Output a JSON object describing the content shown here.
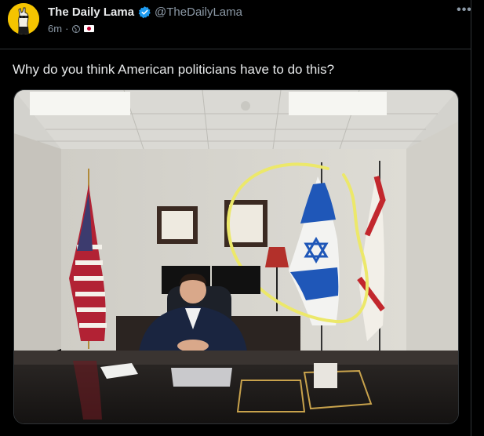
{
  "post": {
    "author_name": "The Daily Lama",
    "handle": "@TheDailyLama",
    "timestamp": "6m",
    "separator": "·",
    "more_label": "•••",
    "text": "Why do you think American politicians have to do this?",
    "icons": {
      "verified": "verified-badge-icon",
      "globe": "globe-icon",
      "flag": "japan-flag-icon",
      "more": "more-options-icon"
    },
    "colors": {
      "background": "#000000",
      "avatar_bg": "#f5c400",
      "verified_blue": "#1d9bf0",
      "text_primary": "#e7e9ea",
      "text_secondary": "#8b98a5"
    }
  },
  "media": {
    "scene": "photo"
  }
}
